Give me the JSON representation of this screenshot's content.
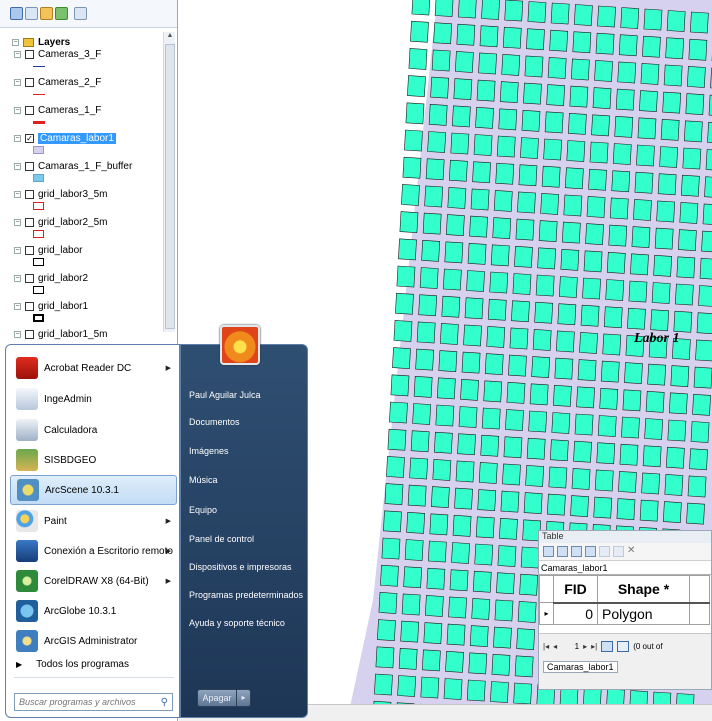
{
  "toc": {
    "root_label": "Layers",
    "layers": [
      {
        "name": "Cameras_3_F",
        "checked": false,
        "symbol": "line-blue"
      },
      {
        "name": "Cameras_2_F",
        "checked": false,
        "symbol": "line-red"
      },
      {
        "name": "Cameras_1_F",
        "checked": false,
        "symbol": "line-red-thick"
      },
      {
        "name": "Camaras_labor1",
        "checked": true,
        "symbol": "fill-lavender",
        "selected": true
      },
      {
        "name": "Camaras_1_F_buffer",
        "checked": false,
        "symbol": "fill-cyan"
      },
      {
        "name": "grid_labor3_5m",
        "checked": false,
        "symbol": "outline-red"
      },
      {
        "name": "grid_labor2_5m",
        "checked": false,
        "symbol": "outline-red"
      },
      {
        "name": "grid_labor",
        "checked": false,
        "symbol": "outline-black"
      },
      {
        "name": "grid_labor2",
        "checked": false,
        "symbol": "outline-black"
      },
      {
        "name": "grid_labor1",
        "checked": false,
        "symbol": "outline-black-thick"
      },
      {
        "name": "grid_labor1_5m",
        "checked": false,
        "symbol": "none"
      }
    ]
  },
  "map": {
    "label": "Labor 1",
    "colors": {
      "fill": "#33ffcc",
      "background": "#d6d1ee",
      "outline": "#1a1a1a"
    }
  },
  "table_window": {
    "title": "Table",
    "layer_tab": "Camaras_labor1",
    "columns": [
      "FID",
      "Shape *"
    ],
    "rows": [
      {
        "fid": "0",
        "shape": "Polygon"
      }
    ],
    "record_number": "1",
    "status": "(0 out of",
    "bottom_tab": "Camaras_labor1"
  },
  "start_menu": {
    "programs": [
      {
        "label": "Acrobat Reader DC",
        "icon": "acrobat-icon",
        "submenu": true
      },
      {
        "label": "IngeAdmin",
        "icon": "ingeadmin-icon",
        "submenu": false
      },
      {
        "label": "Calculadora",
        "icon": "calculator-icon",
        "submenu": false
      },
      {
        "label": "SISBDGEO",
        "icon": "sisbdgeo-icon",
        "submenu": false
      },
      {
        "label": "ArcScene 10.3.1",
        "icon": "arcscene-icon",
        "submenu": false,
        "highlighted": true
      },
      {
        "label": "Paint",
        "icon": "paint-icon",
        "submenu": true
      },
      {
        "label": "Conexión a Escritorio remoto",
        "icon": "remote-desktop-icon",
        "submenu": true
      },
      {
        "label": "CorelDRAW X8 (64-Bit)",
        "icon": "coreldraw-icon",
        "submenu": true
      },
      {
        "label": "ArcGlobe 10.3.1",
        "icon": "arcglobe-icon",
        "submenu": false
      },
      {
        "label": "ArcGIS Administrator",
        "icon": "arcgis-admin-icon",
        "submenu": false
      }
    ],
    "all_programs": "Todos los programas",
    "search_placeholder": "Buscar programas y archivos",
    "right_items": [
      "Paul Aguilar Julca",
      "Documentos",
      "Imágenes",
      "Música",
      "Equipo",
      "Panel de control",
      "Dispositivos e impresoras",
      "Programas predeterminados",
      "Ayuda y soporte técnico"
    ],
    "shutdown_label": "Apagar"
  }
}
